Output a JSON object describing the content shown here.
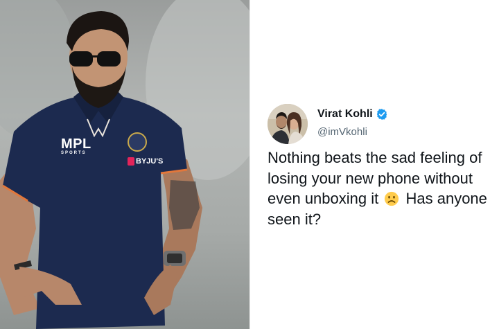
{
  "photo": {
    "logos": {
      "mpl_main": "MPL",
      "mpl_sub": "SPORTS",
      "sponsor": "BYJU'S"
    }
  },
  "tweet": {
    "author_name": "Virat Kohli",
    "author_handle": "@imVkohli",
    "lines": {
      "line1": "Nothing beats the sad feeling of",
      "line2": "losing your new phone without",
      "line3_a": "even unboxing it",
      "line3_b": "Has anyone",
      "line4": "seen it?"
    },
    "icons": {
      "verified": "verified-badge-icon",
      "emoji": "frowning-face-icon"
    }
  },
  "colors": {
    "name_text": "#0f1419",
    "handle_text": "#536471",
    "verified_blue": "#1d9bf0",
    "jersey_navy": "#1c2a4f",
    "background": "#ffffff"
  }
}
